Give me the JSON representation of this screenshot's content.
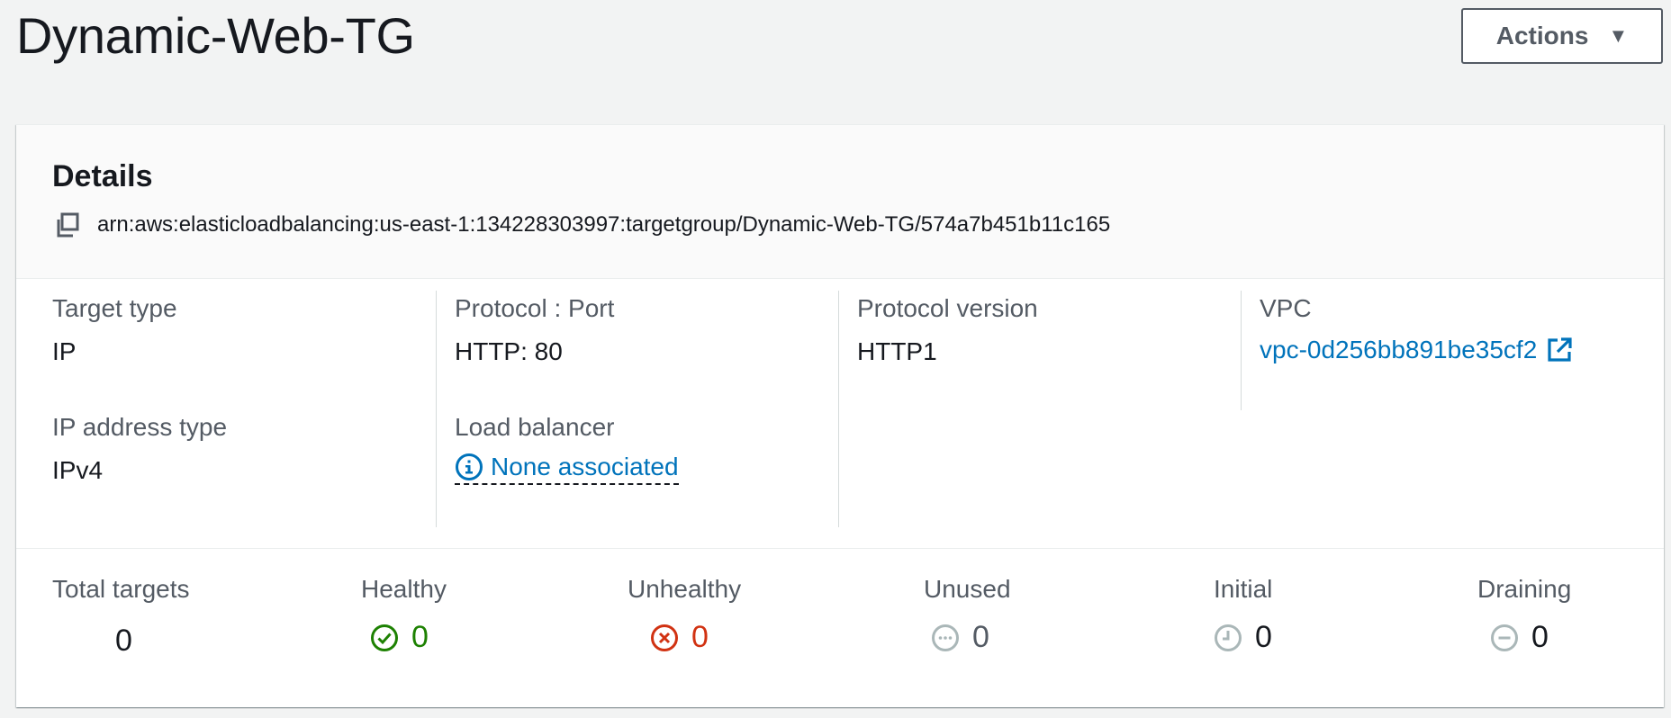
{
  "header": {
    "title": "Dynamic-Web-TG",
    "actions_label": "Actions"
  },
  "details": {
    "title": "Details",
    "arn": "arn:aws:elasticloadbalancing:us-east-1:134228303997:targetgroup/Dynamic-Web-TG/574a7b451b11c165",
    "target_type": {
      "label": "Target type",
      "value": "IP"
    },
    "ip_address_type": {
      "label": "IP address type",
      "value": "IPv4"
    },
    "protocol_port": {
      "label": "Protocol : Port",
      "value": "HTTP: 80"
    },
    "load_balancer": {
      "label": "Load balancer",
      "value": "None associated"
    },
    "protocol_version": {
      "label": "Protocol version",
      "value": "HTTP1"
    },
    "vpc": {
      "label": "VPC",
      "value": "vpc-0d256bb891be35cf2"
    }
  },
  "counts": {
    "total": {
      "label": "Total targets",
      "value": "0"
    },
    "healthy": {
      "label": "Healthy",
      "value": "0"
    },
    "unhealthy": {
      "label": "Unhealthy",
      "value": "0"
    },
    "unused": {
      "label": "Unused",
      "value": "0"
    },
    "initial": {
      "label": "Initial",
      "value": "0"
    },
    "draining": {
      "label": "Draining",
      "value": "0"
    }
  },
  "colors": {
    "link": "#0073bb",
    "healthy": "#1d8102",
    "unhealthy": "#d13212",
    "neutral_icon": "#aab7b8",
    "text": "#16191f",
    "label": "#545b64"
  },
  "icons": {
    "actions": "caret-down-icon",
    "arn": "copy-icon",
    "vpc": "external-link-icon",
    "load_balancer": "info-icon",
    "healthy": "check-circle-icon",
    "unhealthy": "x-circle-icon",
    "unused": "ellipsis-circle-icon",
    "initial": "clock-icon",
    "draining": "minus-circle-icon"
  }
}
